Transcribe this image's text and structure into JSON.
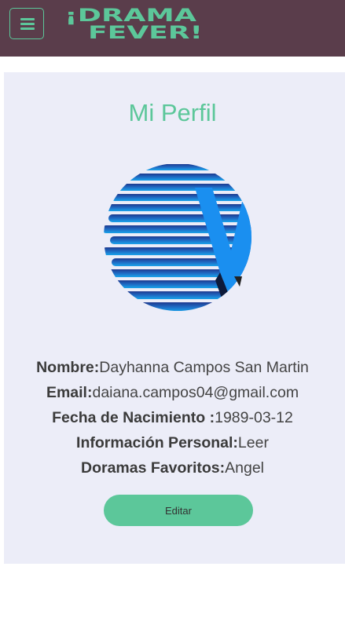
{
  "navbar": {
    "logo_line1": "¡DRAMA",
    "logo_line2": "FEVER!",
    "background": "#5a3d4b",
    "accent": "#5cc79a"
  },
  "profile": {
    "title": "Mi Perfil",
    "fields": [
      {
        "label": "Nombre:",
        "value": "Dayhanna Campos San Martin"
      },
      {
        "label": "Email:",
        "value": "daiana.campos04@gmail.com"
      },
      {
        "label": "Fecha de Nacimiento :",
        "value": "1989-03-12"
      },
      {
        "label": "Información Personal:",
        "value": "Leer"
      },
      {
        "label": "Doramas Favoritos:",
        "value": "Angel"
      }
    ],
    "edit_label": "Editar"
  },
  "icons": [
    "menu-icon",
    "avatar-logo"
  ]
}
